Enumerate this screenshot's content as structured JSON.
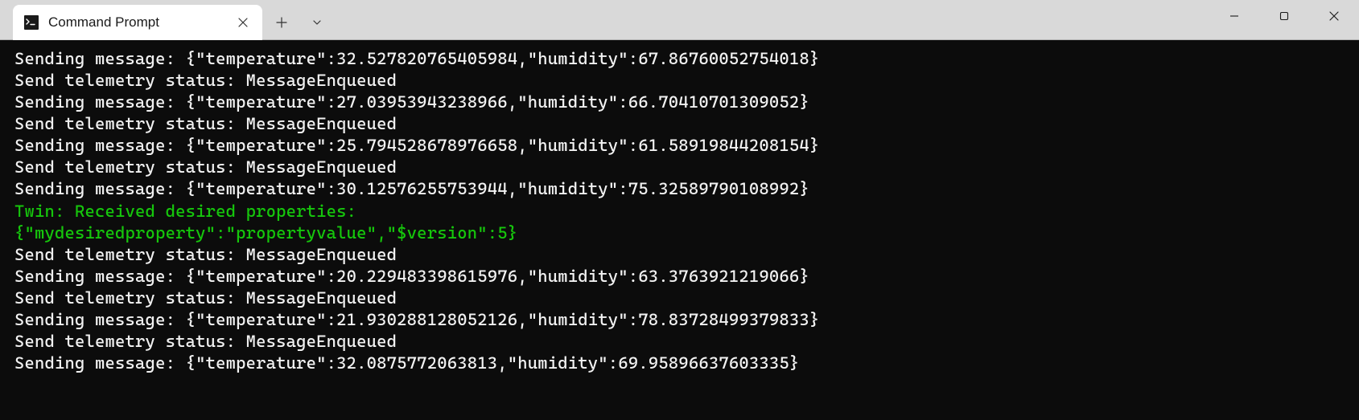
{
  "titlebar": {
    "tab_title": "Command Prompt"
  },
  "terminal": {
    "lines": [
      {
        "text": "Sending message: {\"temperature\":32.527820765405984,\"humidity\":67.86760052754018}",
        "class": ""
      },
      {
        "text": "Send telemetry status: MessageEnqueued",
        "class": ""
      },
      {
        "text": "Sending message: {\"temperature\":27.03953943238966,\"humidity\":66.70410701309052}",
        "class": ""
      },
      {
        "text": "Send telemetry status: MessageEnqueued",
        "class": ""
      },
      {
        "text": "Sending message: {\"temperature\":25.794528678976658,\"humidity\":61.58919844208154}",
        "class": ""
      },
      {
        "text": "Send telemetry status: MessageEnqueued",
        "class": ""
      },
      {
        "text": "Sending message: {\"temperature\":30.12576255753944,\"humidity\":75.32589790108992}",
        "class": ""
      },
      {
        "text": "Twin: Received desired properties:",
        "class": "green"
      },
      {
        "text": "{\"mydesiredproperty\":\"propertyvalue\",\"$version\":5}",
        "class": "green"
      },
      {
        "text": "Send telemetry status: MessageEnqueued",
        "class": ""
      },
      {
        "text": "Sending message: {\"temperature\":20.229483398615976,\"humidity\":63.3763921219066}",
        "class": ""
      },
      {
        "text": "Send telemetry status: MessageEnqueued",
        "class": ""
      },
      {
        "text": "Sending message: {\"temperature\":21.930288128052126,\"humidity\":78.83728499379833}",
        "class": ""
      },
      {
        "text": "Send telemetry status: MessageEnqueued",
        "class": ""
      },
      {
        "text": "Sending message: {\"temperature\":32.0875772063813,\"humidity\":69.95896637603335}",
        "class": ""
      }
    ]
  }
}
